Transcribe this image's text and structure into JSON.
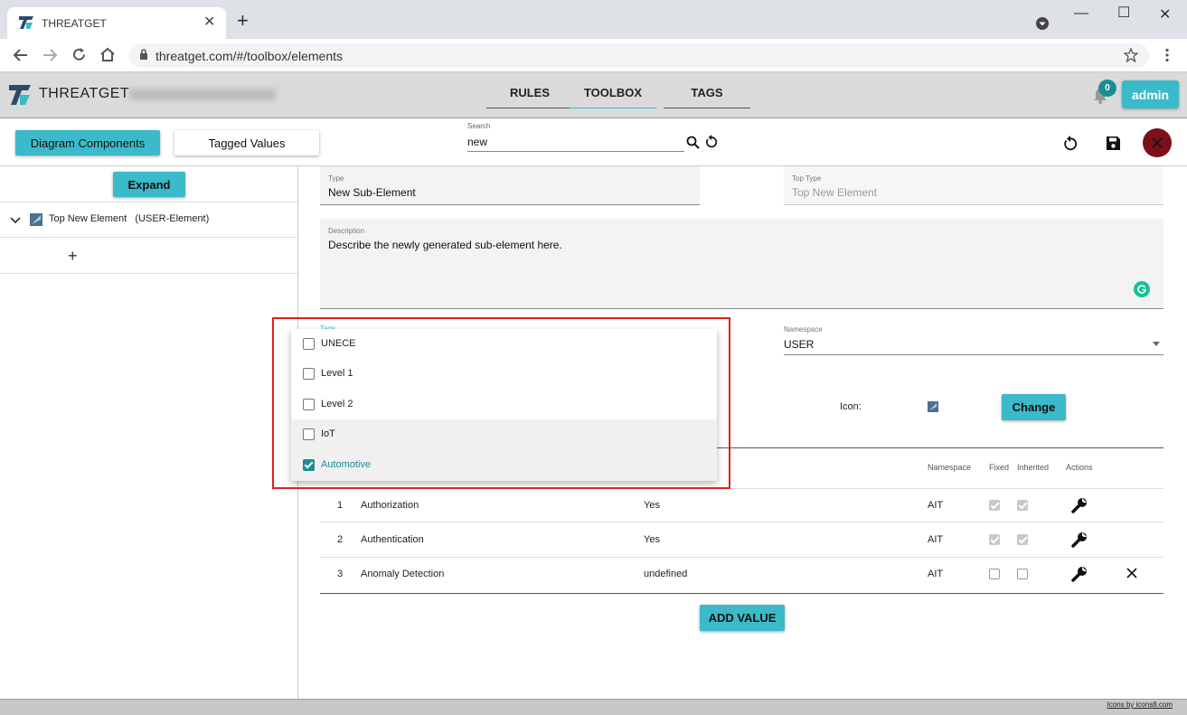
{
  "browser": {
    "tab_title": "THREATGET",
    "tab_close": "✕",
    "new_tab": "+",
    "url": "threatget.com/#/toolbox/elements",
    "window_controls": {
      "minimize": "—",
      "maximize": "☐",
      "close": "✕"
    }
  },
  "header": {
    "app_name": "THREATGET",
    "nav_tabs": [
      {
        "label": "RULES"
      },
      {
        "label": "TOOLBOX"
      },
      {
        "label": "TAGS"
      }
    ],
    "active_tab": "TOOLBOX",
    "notifications_count": "0",
    "user_button": "admin"
  },
  "subbar": {
    "diagram_components_label": "Diagram Components",
    "tagged_values_label": "Tagged Values",
    "search_label": "Search",
    "search_value": "new"
  },
  "left_panel": {
    "expand_label": "Expand",
    "tree_item": "Top New Element   (USER-Element)",
    "add_label": "+"
  },
  "form": {
    "type_label": "Type",
    "type_value": "New Sub-Element",
    "top_type_label": "Top Type",
    "top_type_value": "Top New Element",
    "description_label": "Description",
    "description_value": "Describe the newly generated sub-element here.",
    "tags_label": "Tags",
    "namespace_label": "Namespace",
    "namespace_value": "USER",
    "icon_label": "Icon:",
    "change_label": "Change"
  },
  "tag_options": [
    {
      "label": "UNECE",
      "checked": false
    },
    {
      "label": "Level 1",
      "checked": false
    },
    {
      "label": "Level 2",
      "checked": false
    },
    {
      "label": "IoT",
      "checked": false
    },
    {
      "label": "Automotive",
      "checked": true
    }
  ],
  "table": {
    "headers": {
      "namespace": "Namespace",
      "fixed": "Fixed",
      "inherited": "Inherited",
      "actions": "Actions"
    },
    "rows": [
      {
        "index": "1",
        "name": "Authorization",
        "value": "Yes",
        "namespace": "AIT",
        "fixed": true,
        "inherited": true,
        "deletable": false
      },
      {
        "index": "2",
        "name": "Authentication",
        "value": "Yes",
        "namespace": "AIT",
        "fixed": true,
        "inherited": true,
        "deletable": false
      },
      {
        "index": "3",
        "name": "Anomaly Detection",
        "value": "undefined",
        "namespace": "AIT",
        "fixed": false,
        "inherited": false,
        "deletable": true
      }
    ],
    "add_value_label": "ADD VALUE"
  },
  "footer": {
    "credit": "Icons by icons8.com"
  },
  "colors": {
    "accent": "#3bbac9",
    "teal_dark": "#1a8d93",
    "close_red": "#7b0f1b",
    "highlight": "#e02020"
  }
}
